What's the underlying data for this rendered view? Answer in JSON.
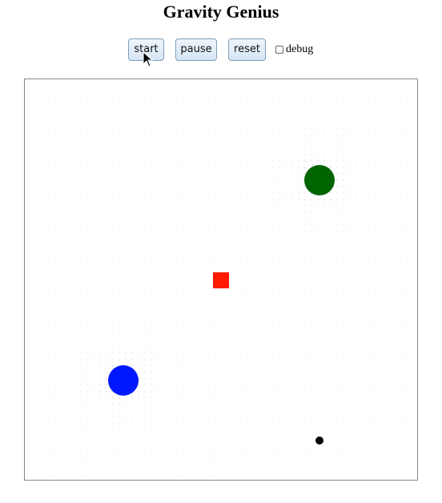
{
  "app": {
    "title": "Gravity Genius"
  },
  "toolbar": {
    "start_label": "start",
    "pause_label": "pause",
    "reset_label": "reset",
    "debug_label": "debug",
    "debug_checked": false
  },
  "simulation": {
    "bodies": [
      {
        "name": "green-planet",
        "color": "#006400"
      },
      {
        "name": "blue-planet",
        "color": "#0018ff"
      },
      {
        "name": "red-square",
        "color": "#ff1a00"
      },
      {
        "name": "black-particle",
        "color": "#000000"
      }
    ],
    "field_color": "#b8b8c8"
  }
}
